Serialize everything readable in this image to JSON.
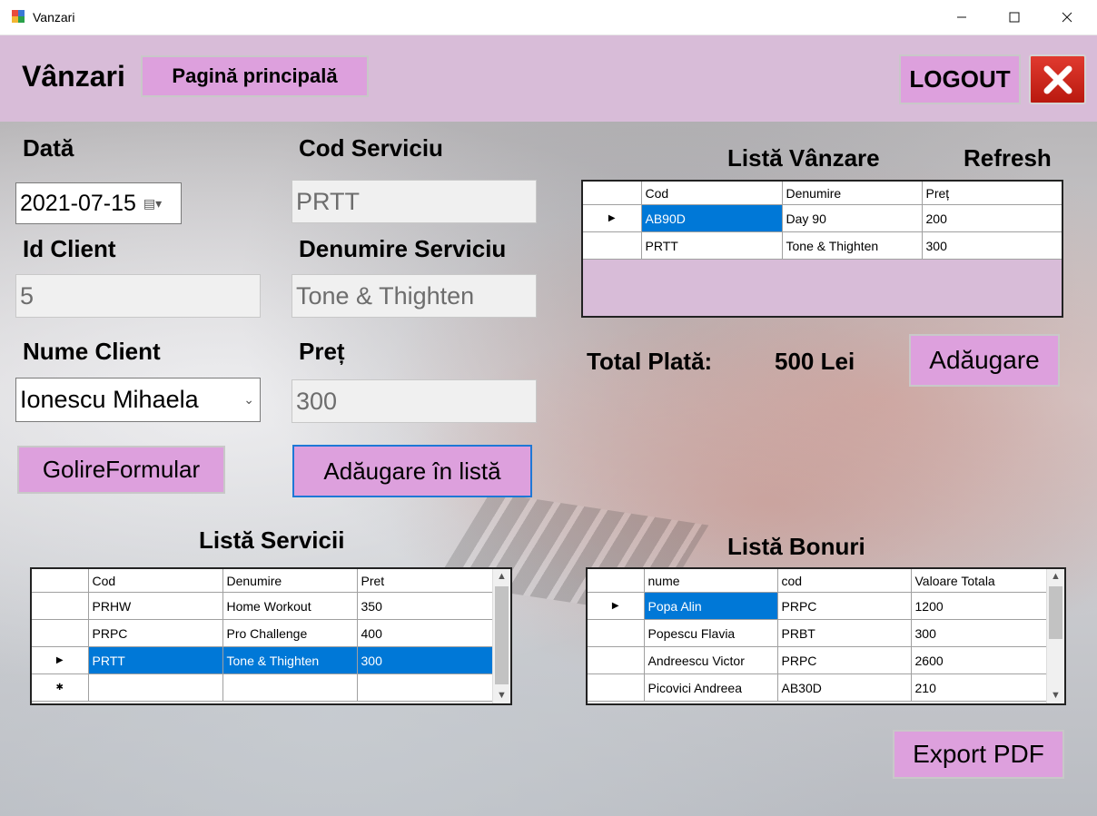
{
  "window": {
    "title": "Vanzari"
  },
  "header": {
    "title": "Vânzari",
    "home_button": "Pagină principală",
    "logout_button": "LOGOUT"
  },
  "form": {
    "data_label": "Dată",
    "data_value": "2021-07-15",
    "id_client_label": "Id Client",
    "id_client_value": "5",
    "nume_client_label": "Nume Client",
    "nume_client_value": "Ionescu Mihaela",
    "cod_serviciu_label": "Cod Serviciu",
    "cod_serviciu_value": "PRTT",
    "denumire_label": "Denumire Serviciu",
    "denumire_value": "Tone & Thighten",
    "pret_label": "Preț",
    "pret_value": "300",
    "golire_button": "GolireFormular",
    "adaugare_lista_button": "Adăugare în listă"
  },
  "vanzare": {
    "title": "Listă Vânzare",
    "refresh": "Refresh",
    "columns": [
      "Cod",
      "Denumire",
      "Preț"
    ],
    "rows": [
      [
        "AB90D",
        "Day 90",
        "200"
      ],
      [
        "PRTT",
        "Tone & Thighten",
        "300"
      ]
    ],
    "total_label": "Total Plată:",
    "total_value": "500 Lei",
    "adaugare_button": "Adăugare"
  },
  "servicii": {
    "title": "Listă Servicii",
    "columns": [
      "Cod",
      "Denumire",
      "Pret"
    ],
    "rows": [
      [
        "PRHW",
        "Home Workout",
        "350"
      ],
      [
        "PRPC",
        "Pro Challenge",
        "400"
      ],
      [
        "PRTT",
        "Tone & Thighten",
        "300"
      ]
    ]
  },
  "bonuri": {
    "title": "Listă Bonuri",
    "columns": [
      "nume",
      "cod",
      "Valoare Totala"
    ],
    "rows": [
      [
        "Popa Alin",
        "PRPC",
        "1200"
      ],
      [
        "Popescu Flavia",
        "PRBT",
        "300"
      ],
      [
        "Andreescu Victor",
        "PRPC",
        "2600"
      ],
      [
        "Picovici Andreea",
        "AB30D",
        "210"
      ]
    ]
  },
  "export_button": "Export PDF"
}
